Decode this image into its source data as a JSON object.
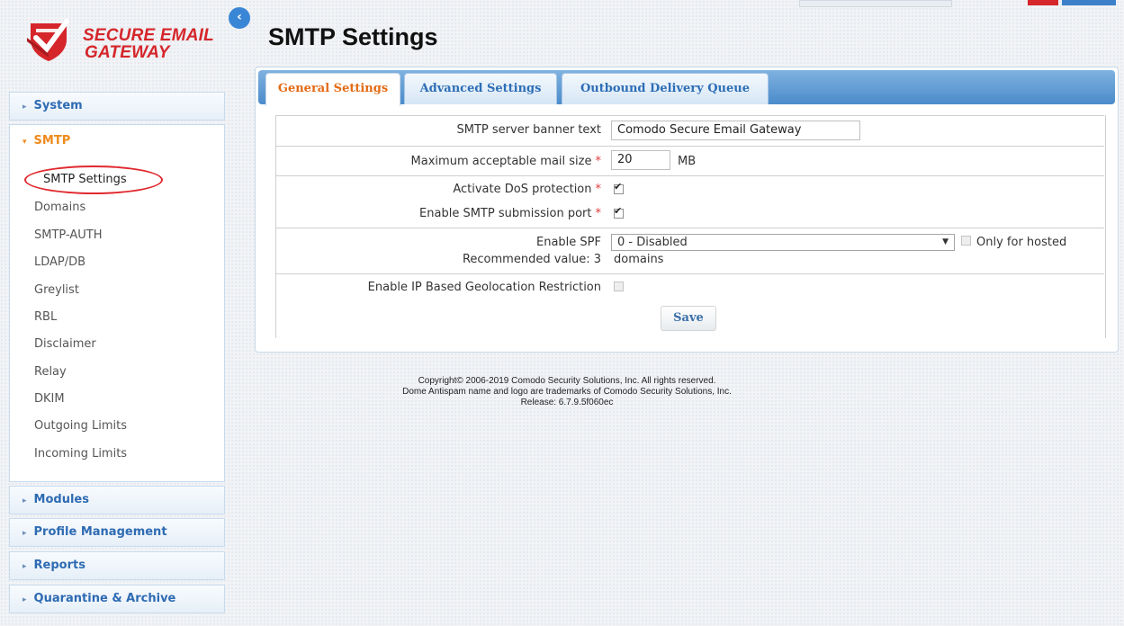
{
  "brand": {
    "line1": "SECURE EMAIL",
    "line2": "GATEWAY"
  },
  "icons": {
    "collapse": "chevron-left-icon",
    "logo": "shield-check-icon",
    "tree_closed": "triangle-right-icon",
    "tree_open": "triangle-down-icon",
    "select_arrow": "caret-down-icon"
  },
  "sidebar": {
    "groups": [
      {
        "label": "System",
        "open": false
      },
      {
        "label": "SMTP",
        "open": true
      },
      {
        "label": "Modules",
        "open": false
      },
      {
        "label": "Profile Management",
        "open": false
      },
      {
        "label": "Reports",
        "open": false
      },
      {
        "label": "Quarantine & Archive",
        "open": false
      }
    ],
    "smtp_items": [
      "SMTP Settings",
      "Domains",
      "SMTP-AUTH",
      "LDAP/DB",
      "Greylist",
      "RBL",
      "Disclaimer",
      "Relay",
      "DKIM",
      "Outgoing Limits",
      "Incoming Limits"
    ],
    "selected_item": "SMTP Settings"
  },
  "page": {
    "title": "SMTP Settings"
  },
  "tabs": [
    {
      "label": "General Settings",
      "active": true
    },
    {
      "label": "Advanced Settings",
      "active": false
    },
    {
      "label": "Outbound Delivery Queue",
      "active": false
    }
  ],
  "form": {
    "banner_label": "SMTP server banner text",
    "banner_value": "Comodo Secure Email Gateway",
    "maxsize_label": "Maximum acceptable mail size",
    "maxsize_value": "20",
    "maxsize_unit": "MB",
    "dos_label": "Activate DoS protection",
    "dos_checked": true,
    "submission_label": "Enable SMTP submission port",
    "submission_checked": true,
    "spf_label": "Enable SPF",
    "spf_hint": "Recommended value: 3",
    "spf_value": "0 - Disabled",
    "spf_hosted_label": "Only for hosted",
    "spf_hosted_label2": "domains",
    "spf_hosted_checked": false,
    "geo_label": "Enable IP Based Geolocation Restriction",
    "geo_checked": false,
    "required_mark": "*",
    "save_label": "Save"
  },
  "footer": {
    "line1": "Copyright© 2006-2019 Comodo Security Solutions, Inc. All rights reserved.",
    "line2": "Dome Antispam name and logo are trademarks of Comodo Security Solutions, Inc.",
    "line3": "Release: 6.7.9.5f060ec"
  },
  "colors": {
    "brand_red": "#d5262b",
    "link_blue": "#2e6bb3",
    "active_orange": "#e36a14",
    "tab_blue": "#4b8ccb"
  }
}
